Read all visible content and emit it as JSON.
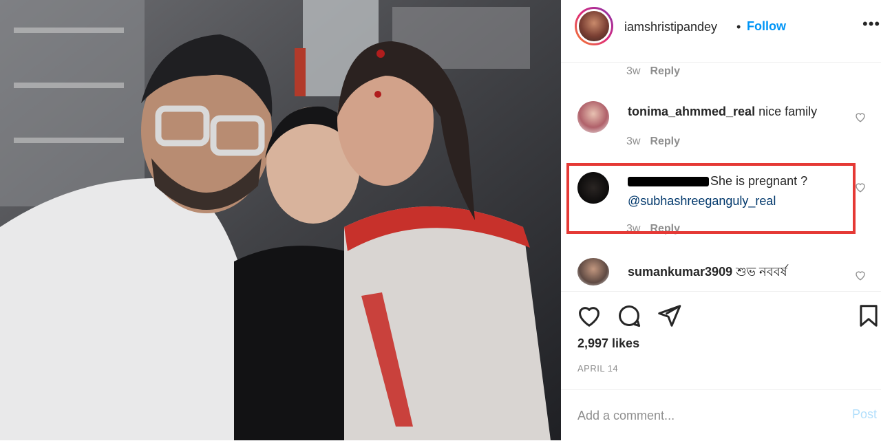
{
  "post": {
    "username": "iamshristipandey",
    "separator": "•",
    "follow_label": "Follow",
    "more_icon": "more-horizontal-icon",
    "photo_alt": "Selfie of three people"
  },
  "comments": [
    {
      "meta_time": "3w",
      "reply_label": "Reply"
    },
    {
      "username": "tonima_ahmmed_real",
      "text": "nice family",
      "time": "3w",
      "reply_label": "Reply"
    },
    {
      "username_redacted": true,
      "text": "She is pregnant ?",
      "mention": "@subhashreeganguly_real",
      "time": "3w",
      "reply_label": "Reply",
      "highlight_color": "#e53935"
    },
    {
      "username": "sumankumar3909",
      "text": "শুভ নববর্ষ"
    }
  ],
  "actions": {
    "like_icon": "heart-icon",
    "comment_icon": "comment-bubble-icon",
    "share_icon": "paper-plane-icon",
    "save_icon": "bookmark-icon",
    "likes_text": "2,997 likes",
    "date_text": "APRIL 14"
  },
  "add_comment": {
    "placeholder": "Add a comment...",
    "post_label": "Post"
  },
  "colors": {
    "link": "#0095f6",
    "mention": "#00376b",
    "muted": "#8e8e8e",
    "post_disabled": "#b2dffc"
  }
}
